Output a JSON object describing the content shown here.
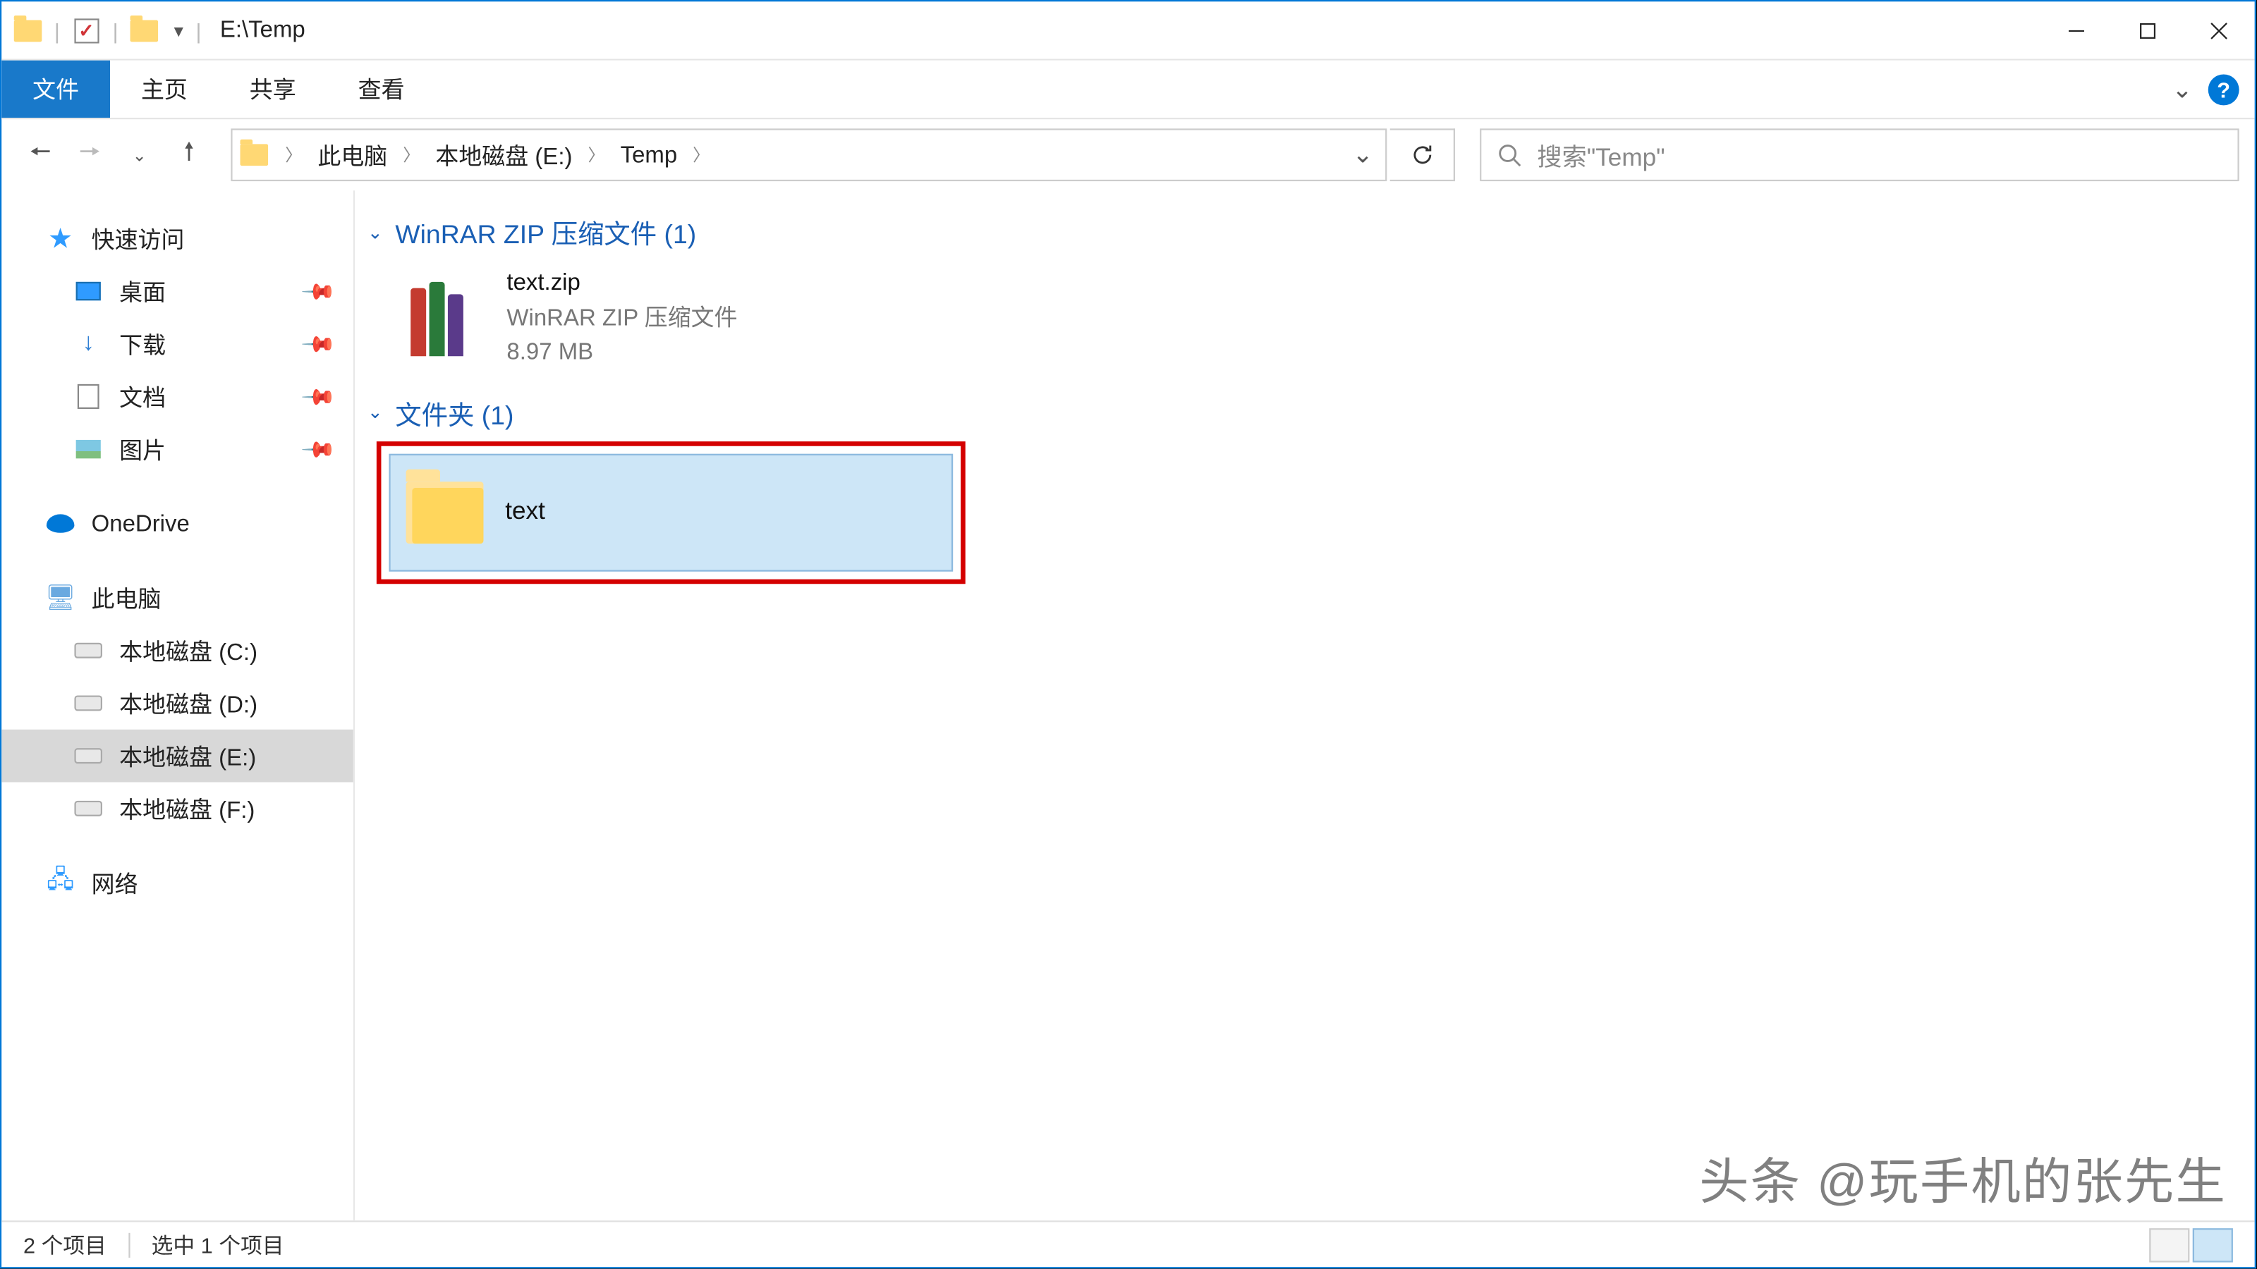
{
  "title": "E:\\Temp",
  "ribbon": {
    "file": "文件",
    "home": "主页",
    "share": "共享",
    "view": "查看"
  },
  "breadcrumbs": [
    "此电脑",
    "本地磁盘 (E:)",
    "Temp"
  ],
  "search_placeholder": "搜索\"Temp\"",
  "sidebar": {
    "quick_access": "快速访问",
    "desktop": "桌面",
    "downloads": "下载",
    "documents": "文档",
    "pictures": "图片",
    "onedrive": "OneDrive",
    "this_pc": "此电脑",
    "drive_c": "本地磁盘 (C:)",
    "drive_d": "本地磁盘 (D:)",
    "drive_e": "本地磁盘 (E:)",
    "drive_f": "本地磁盘 (F:)",
    "network": "网络"
  },
  "groups": {
    "zip_header": "WinRAR ZIP 压缩文件 (1)",
    "folder_header": "文件夹 (1)"
  },
  "zip_item": {
    "name": "text.zip",
    "type": "WinRAR ZIP 压缩文件",
    "size": "8.97 MB"
  },
  "folder_item": {
    "name": "text"
  },
  "status": {
    "count": "2 个项目",
    "selected": "选中 1 个项目"
  },
  "watermark": "头条 @玩手机的张先生"
}
